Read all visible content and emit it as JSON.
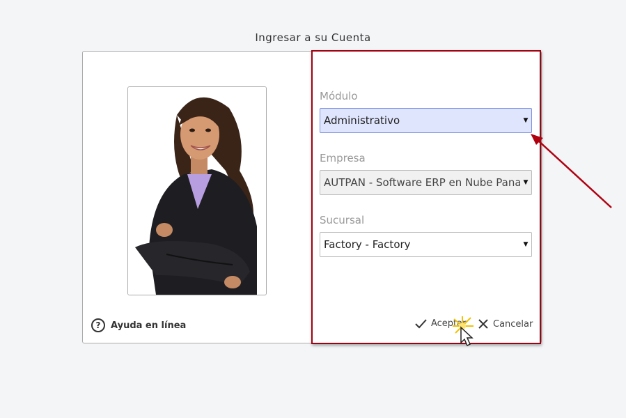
{
  "page": {
    "title": "Ingresar a su Cuenta"
  },
  "help": {
    "label": "Ayuda en línea"
  },
  "form": {
    "modulo": {
      "label": "Módulo",
      "value": "Administrativo"
    },
    "empresa": {
      "label": "Empresa",
      "value": "AUTPAN - Software ERP en Nube Pana"
    },
    "sucursal": {
      "label": "Sucursal",
      "value": "Factory - Factory"
    }
  },
  "buttons": {
    "accept": "Aceptar",
    "cancel": "Cancelar"
  },
  "colors": {
    "highlight": "#a00010",
    "active_select": "#dfe5fd",
    "arrow": "#b00010"
  }
}
